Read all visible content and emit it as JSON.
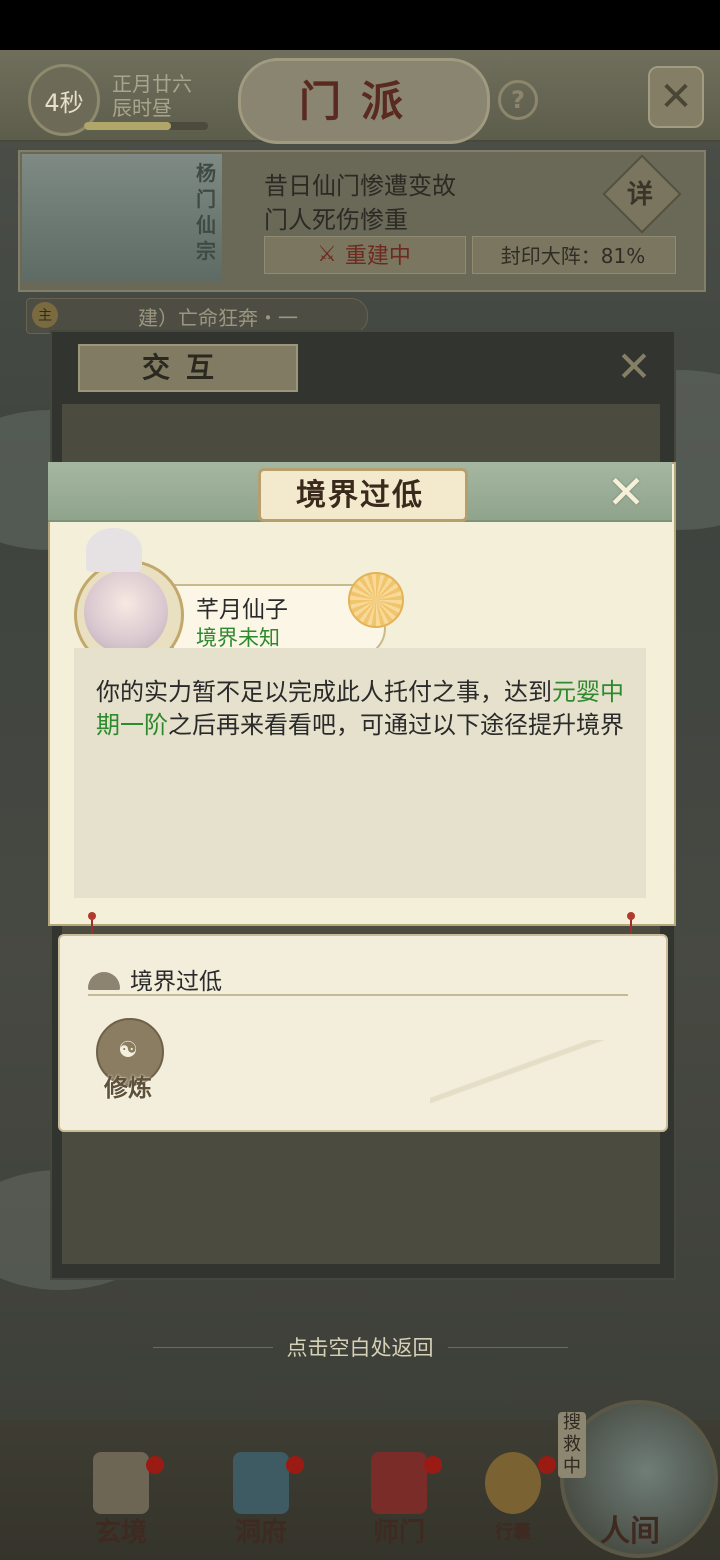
{
  "top_bar": {
    "timer": "4秒",
    "date_line1": "正月廿六",
    "date_line2": "辰时昼",
    "time_progress": 0.7,
    "title": "门派",
    "help_icon": "question-icon",
    "close_icon": "crossed-swords-close-icon"
  },
  "sect": {
    "name": "杨门仙宗",
    "desc_line1": "昔日仙门惨遭变故",
    "desc_line2": "门人死伤惨重",
    "detail_label": "详",
    "rebuild_label": "重建中",
    "seal_label": "封印大阵：81%"
  },
  "quest": {
    "badge": "主",
    "text": "建）亡命狂奔・一"
  },
  "back_dialog": {
    "title": "交互"
  },
  "dialog": {
    "title": "境界过低",
    "npc_name": "芊月仙子",
    "npc_realm": "境界未知",
    "message_part1": "你的实力暂不足以完成此人托付之事，达到",
    "message_highlight": "元婴中期一阶",
    "message_part2": "之后再来看看吧，可通过以下途径提升境界",
    "highlight_color": "#2e8a2e"
  },
  "sub_panel": {
    "title": "境界过低",
    "action_label": "修炼"
  },
  "hint": "点击空白处返回",
  "bottom_nav": {
    "items": [
      {
        "label": "玄境",
        "icon": "scroll-icon"
      },
      {
        "label": "洞府",
        "icon": "lantern-icon"
      },
      {
        "label": "师门",
        "icon": "banner-icon"
      },
      {
        "label": "行囊",
        "icon": "pouch-icon"
      }
    ],
    "world_search": "搜救中",
    "world_label": "人间"
  }
}
